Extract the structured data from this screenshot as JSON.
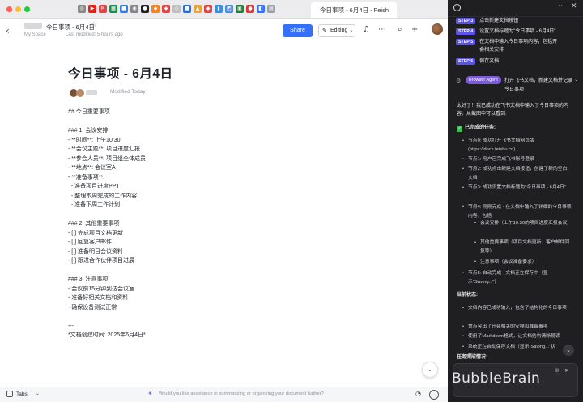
{
  "browser": {
    "active_tab_title": "今日事项 - 6月4日 - Feishu..."
  },
  "header": {
    "doc_title": "今日事项 - 6月4日",
    "breadcrumb_space": "My Space",
    "last_modified": "Last modified: 5 hours ago",
    "share_label": "Share",
    "editing_label": "Editing"
  },
  "doc": {
    "title": "今日事项 - 6月4日",
    "modified": "Modified Today",
    "lines": [
      "## 今日重要事项",
      "",
      "### 1. 会议安排",
      "- **时间**: 上午10:30",
      "- **会议主题**: 项目进度汇报",
      "- **参会人员**: 项目组全体成员",
      "- **地点**: 会议室A",
      "- **准备事项**:",
      "  - 准备项目进度PPT",
      "  - 整理本周完成的工作内容",
      "  - 准备下周工作计划",
      "",
      "### 2. 其他重要事项",
      "- [ ] 完成项目文档更新",
      "- [ ] 回复客户邮件",
      "- [ ] 准备明日会议资料",
      "- [ ] 跟进合作伙伴项目进展",
      "",
      "### 3. 注意事项",
      "- 会议前15分钟到达会议室",
      "- 准备好相关文档和资料",
      "- 确保设备测试正常",
      "",
      "---",
      "*文档创建时间: 2025年6月4日*"
    ]
  },
  "footer": {
    "tabs_label": "Tabs",
    "assist_text": "Would you like assistance in summarizing or organizing your document further?"
  },
  "panel": {
    "steps": [
      {
        "badge": "STEP 3",
        "text": "点击新建文档按钮"
      },
      {
        "badge": "STEP 4",
        "text": "设置文档标题为\"今日事项 - 6月4日\""
      },
      {
        "badge": "STEP 5",
        "text": "在文档中输入今日事项内容，包括开会相关安排"
      },
      {
        "badge": "STEP 6",
        "text": "保存文档"
      }
    ],
    "agent_badge": "Browser Agent",
    "agent_text": "打开飞书文档，新建文档并记录今日事项",
    "intro": "太好了！我已成功在飞书文档中输入了今日事项的内容。从截图中可以看到:",
    "done_title": "已完成的任务:",
    "done_items": [
      "节点0: 成功打开飞书文档网页版(https://docs.feishu.cn)",
      "节点1: 用户已完成飞书账号登录",
      "节点2: 成功点击新建文档按钮，创建了新的空白文档",
      "节点3: 成功设置文档标题为\"今日事项 - 6月4日\"",
      "节点4: 刚刚完成 - 在文档中输入了详细的今日事项内容，包括:",
      "节点5: 自动完成 - 文档正在保存中（显示\"Saving...\"）"
    ],
    "sub_items": [
      "会议安排（上午10:30的项目进度汇报会议）",
      "其他重要事项（项目文档更新、客户邮件回复等）",
      "注意事项（会议准备要求）"
    ],
    "state_title": "当前状态:",
    "state_items": [
      "文档内容已成功输入，包含了结构化的今日事项",
      "重点突出了开会相关的安排和准备事项",
      "使用了Markdown格式，让文档结构清晰易读",
      "系统正在自动保存文档（显示\"Saving...\"状态）"
    ],
    "next_title": "任务完成情况:",
    "watermark": "BubbleBrain"
  },
  "colors": {
    "share_blue": "#3370ff",
    "step_badge": "#5b53e6",
    "agent_pill": "#7b5bd6",
    "check_green": "#3dbb55"
  }
}
